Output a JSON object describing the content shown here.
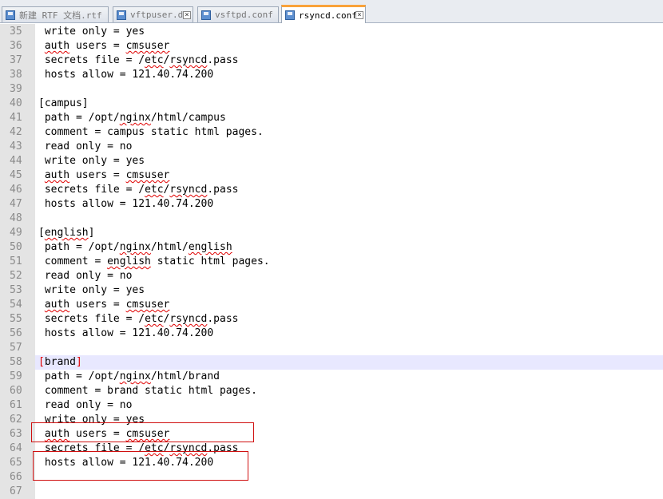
{
  "tabs": [
    {
      "label": "新建 RTF 文档.rtf",
      "active": false
    },
    {
      "label": "vftpuser.db",
      "active": false
    },
    {
      "label": "vsftpd.conf",
      "active": false
    },
    {
      "label": "rsyncd.conf",
      "active": true
    }
  ],
  "lines": [
    {
      "n": "35",
      "text": " write only = yes"
    },
    {
      "n": "36",
      "text": " auth users = cmsuser"
    },
    {
      "n": "37",
      "text": " secrets file = /etc/rsyncd.pass"
    },
    {
      "n": "38",
      "text": " hosts allow = 121.40.74.200"
    },
    {
      "n": "39",
      "text": ""
    },
    {
      "n": "40",
      "text": "[campus]"
    },
    {
      "n": "41",
      "text": " path = /opt/nginx/html/campus"
    },
    {
      "n": "42",
      "text": " comment = campus static html pages."
    },
    {
      "n": "43",
      "text": " read only = no"
    },
    {
      "n": "44",
      "text": " write only = yes"
    },
    {
      "n": "45",
      "text": " auth users = cmsuser"
    },
    {
      "n": "46",
      "text": " secrets file = /etc/rsyncd.pass"
    },
    {
      "n": "47",
      "text": " hosts allow = 121.40.74.200"
    },
    {
      "n": "48",
      "text": ""
    },
    {
      "n": "49",
      "text": "[english]"
    },
    {
      "n": "50",
      "text": " path = /opt/nginx/html/english"
    },
    {
      "n": "51",
      "text": " comment = english static html pages."
    },
    {
      "n": "52",
      "text": " read only = no"
    },
    {
      "n": "53",
      "text": " write only = yes"
    },
    {
      "n": "54",
      "text": " auth users = cmsuser"
    },
    {
      "n": "55",
      "text": " secrets file = /etc/rsyncd.pass"
    },
    {
      "n": "56",
      "text": " hosts allow = 121.40.74.200"
    },
    {
      "n": "57",
      "text": ""
    },
    {
      "n": "58",
      "text": "[brand]"
    },
    {
      "n": "59",
      "text": " path = /opt/nginx/html/brand"
    },
    {
      "n": "60",
      "text": " comment = brand static html pages."
    },
    {
      "n": "61",
      "text": " read only = no"
    },
    {
      "n": "62",
      "text": " write only = yes"
    },
    {
      "n": "63",
      "text": " auth users = cmsuser"
    },
    {
      "n": "64",
      "text": " secrets file = /etc/rsyncd.pass"
    },
    {
      "n": "65",
      "text": " hosts allow = 121.40.74.200"
    },
    {
      "n": "66",
      "text": ""
    },
    {
      "n": "67",
      "text": ""
    }
  ],
  "current_line": "58",
  "spellcheck_words": [
    "auth",
    "cmsuser",
    "etc",
    "rsyncd",
    "nginx",
    "english"
  ],
  "colors": {
    "active_tab_accent": "#f9a23a",
    "spell_underline": "#e00000",
    "current_line_bg": "#e8e8ff",
    "annotation_box": "#d01010"
  }
}
